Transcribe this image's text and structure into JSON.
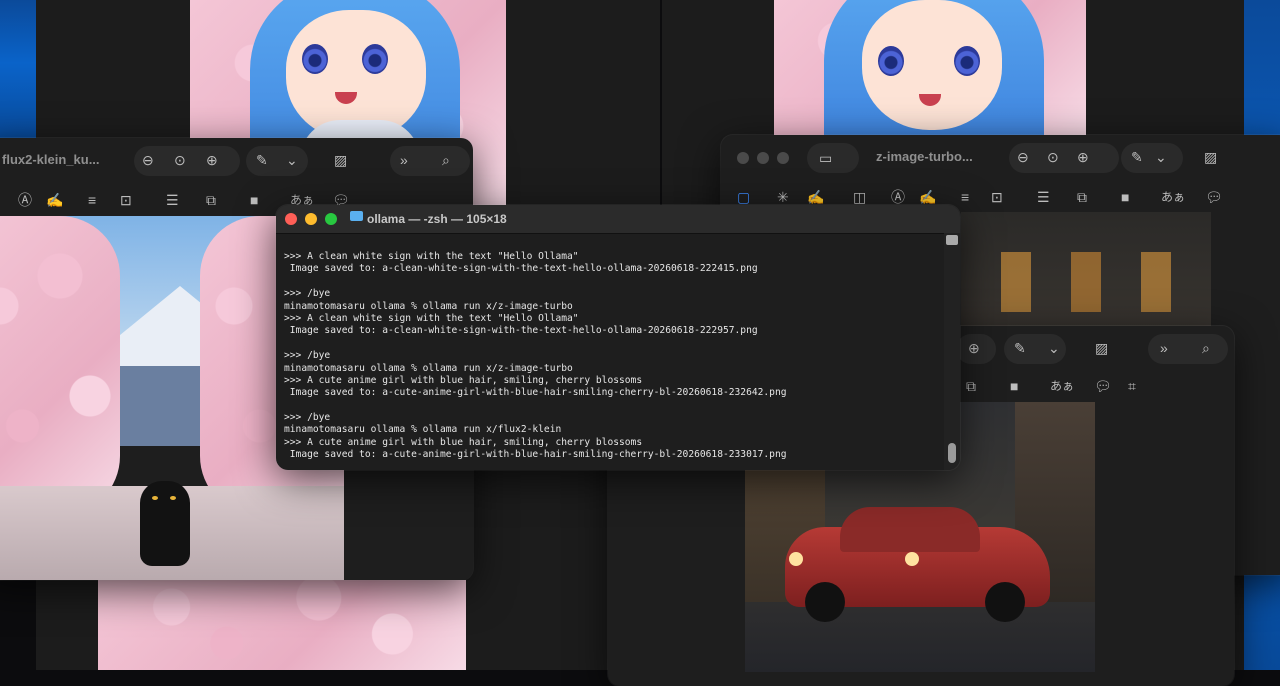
{
  "colors": {
    "terminal_bg": "#1e1e1e",
    "terminal_text": "#e6e6e6",
    "window_bg": "#1e1e1e",
    "accent_blue": "#0a63c9",
    "close": "#ff5f57",
    "minimize": "#febc2e",
    "zoom": "#28c840"
  },
  "windows": {
    "left_preview": {
      "title": "flux2-klein_ku...",
      "toolbar_text_glyph": "あぁ"
    },
    "right_preview": {
      "title": "z-image-turbo...",
      "toolbar_text_glyph": "あぁ"
    },
    "bottom_right_preview": {
      "toolbar_text_glyph": "あぁ"
    }
  },
  "terminal": {
    "title": "ollama — -zsh — 105×18",
    "lines": [
      ">>> A clean white sign with the text \"Hello Ollama\"",
      " Image saved to: a-clean-white-sign-with-the-text-hello-ollama-20260618-222415.png",
      "",
      ">>> /bye",
      "minamotomasaru ollama % ollama run x/z-image-turbo",
      ">>> A clean white sign with the text \"Hello Ollama\"",
      " Image saved to: a-clean-white-sign-with-the-text-hello-ollama-20260618-222957.png",
      "",
      ">>> /bye",
      "minamotomasaru ollama % ollama run x/z-image-turbo",
      ">>> A cute anime girl with blue hair, smiling, cherry blossoms",
      " Image saved to: a-cute-anime-girl-with-blue-hair-smiling-cherry-bl-20260618-232642.png",
      "",
      ">>> /bye",
      "minamotomasaru ollama % ollama run x/flux2-klein",
      ">>> A cute anime girl with blue hair, smiling, cherry blossoms",
      " Image saved to: a-cute-anime-girl-with-blue-hair-smiling-cherry-bl-20260618-233017.png"
    ]
  }
}
